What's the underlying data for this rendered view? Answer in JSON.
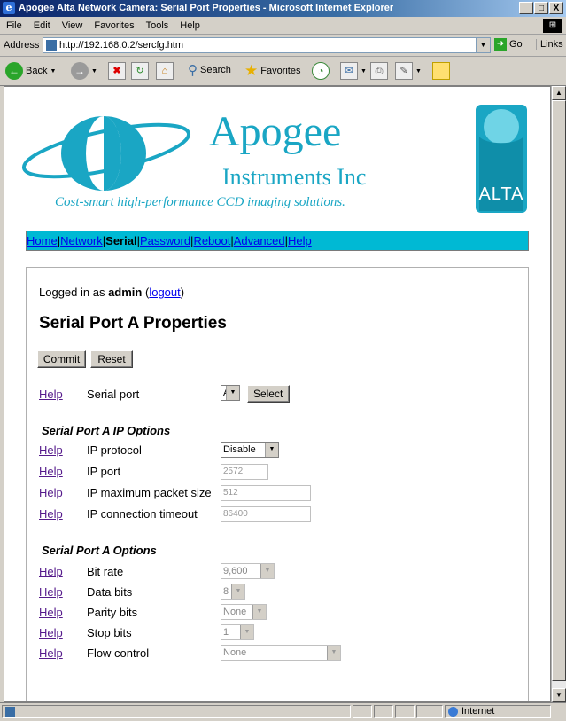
{
  "window": {
    "title": "Apogee Alta Network Camera: Serial Port Properties - Microsoft Internet Explorer",
    "buttons": [
      "_",
      "□",
      "X"
    ]
  },
  "menubar": [
    "File",
    "Edit",
    "View",
    "Favorites",
    "Tools",
    "Help"
  ],
  "address": {
    "label": "Address",
    "url": "http://192.168.0.2/sercfg.htm",
    "go_label": "Go",
    "links_label": "Links"
  },
  "toolbar": {
    "back_label": "Back",
    "search_label": "Search",
    "favorites_label": "Favorites"
  },
  "logo": {
    "brand": "Apogee",
    "company": "Instruments Inc",
    "tagline": "Cost-smart high-performance CCD imaging solutions.",
    "badge_text": "ALTA"
  },
  "nav": {
    "items": [
      {
        "label": "Home",
        "current": false
      },
      {
        "label": "Network",
        "current": false
      },
      {
        "label": "Serial",
        "current": true
      },
      {
        "label": "Password",
        "current": false
      },
      {
        "label": "Reboot",
        "current": false
      },
      {
        "label": "Advanced",
        "current": false
      },
      {
        "label": "Help",
        "current": false
      }
    ],
    "separator": "|"
  },
  "session": {
    "prefix": "Logged in as ",
    "user": "admin",
    "logout_label": "logout"
  },
  "page": {
    "heading": "Serial Port A Properties",
    "commit_label": "Commit",
    "reset_label": "Reset",
    "help_label": "Help",
    "serial_port_label": "Serial port",
    "serial_port_value": "A",
    "select_label": "Select",
    "ip_section_title": "Serial Port A IP Options",
    "ip_protocol_label": "IP protocol",
    "ip_protocol_value": "Disable",
    "ip_port_label": "IP port",
    "ip_port_value": "2572",
    "ip_max_packet_label": "IP maximum packet size",
    "ip_max_packet_value": "512",
    "ip_timeout_label": "IP connection timeout",
    "ip_timeout_value": "86400",
    "options_section_title": "Serial Port A Options",
    "bit_rate_label": "Bit rate",
    "bit_rate_value": "9,600",
    "data_bits_label": "Data bits",
    "data_bits_value": "8",
    "parity_bits_label": "Parity bits",
    "parity_bits_value": "None",
    "stop_bits_label": "Stop bits",
    "stop_bits_value": "1",
    "flow_control_label": "Flow control",
    "flow_control_value": "None"
  },
  "status": {
    "zone": "Internet"
  },
  "colors": {
    "nav_bg": "#00b9d4",
    "logo_teal": "#1aa6c4",
    "titlebar": "#0a246a"
  }
}
